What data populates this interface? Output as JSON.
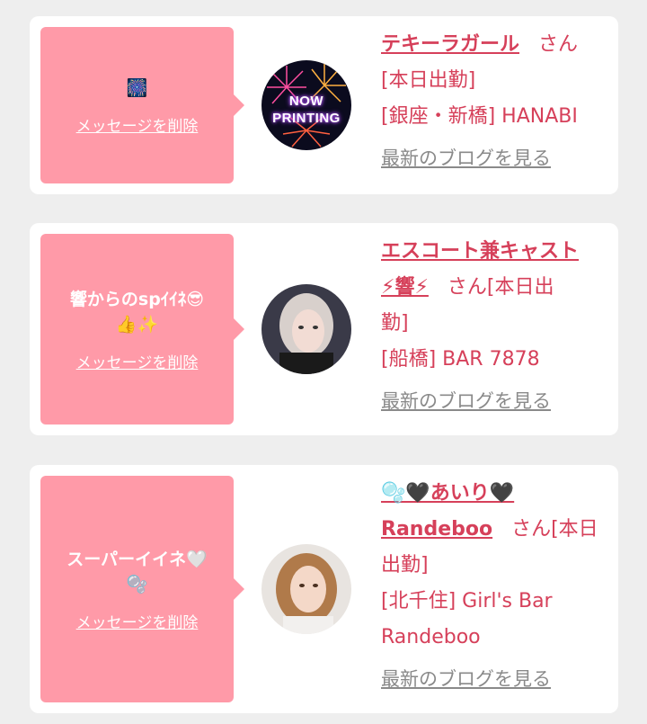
{
  "colors": {
    "bubble": "#ff9aa8",
    "name": "#d6405a",
    "link_gray": "#8a8a8a",
    "background": "#eeeeee"
  },
  "cards": [
    {
      "message": "",
      "message_emoji": "🎆",
      "delete_label": "メッセージを削除",
      "avatar_text_1": "NOW",
      "avatar_text_2": "PRINTING",
      "name": "テキーラガール",
      "san": "さん",
      "status": "[本日出勤]",
      "shop": "[銀座・新橋] HANABI",
      "blog_label": "最新のブログを見る"
    },
    {
      "message": "響からのspｲｲﾈ😎",
      "message_emoji": "👍✨",
      "delete_label": "メッセージを削除",
      "name_line1": "エスコート兼キャスト",
      "name_line2": "⚡響⚡",
      "san": "さん[本日出",
      "status": "勤]",
      "shop": "[船橋] BAR 7878",
      "blog_label": "最新のブログを見る"
    },
    {
      "message": "スーパーイイネ🤍",
      "message_emoji": "🫧",
      "delete_label": "メッセージを削除",
      "name_line1": "🫧🖤あいり🖤",
      "name_line2": "Randeboo",
      "san": "さん[本日",
      "status": "出勤]",
      "shop_line1": "[北千住] Girl's Bar",
      "shop_line2": "Randeboo",
      "blog_label": "最新のブログを見る"
    }
  ]
}
